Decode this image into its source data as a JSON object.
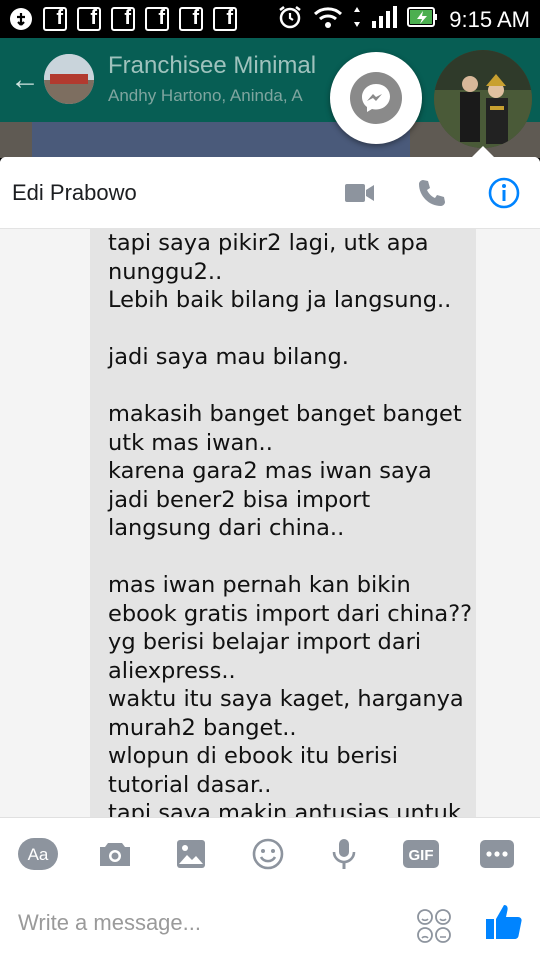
{
  "status_bar": {
    "time": "9:15 AM",
    "icons": [
      "usb-icon",
      "facebook-icon",
      "facebook-icon",
      "facebook-icon",
      "facebook-icon",
      "facebook-icon",
      "facebook-icon",
      "alarm-icon",
      "wifi-icon",
      "signal-icon",
      "battery-charging-icon"
    ]
  },
  "background_app": {
    "title": "Franchisee Minimal",
    "subtitle": "Andhy Hartono, Aninda, A"
  },
  "conversation": {
    "contact_name": "Edi Prabowo",
    "actions": [
      "video-call-icon",
      "phone-call-icon",
      "info-icon"
    ],
    "message_lines": [
      "tapi saya pikir2 lagi, utk apa",
      "nunggu2..",
      "Lebih baik bilang ja langsung..",
      "",
      "jadi saya mau bilang.",
      "",
      "makasih banget banget banget",
      "utk mas iwan..",
      "karena gara2 mas iwan saya",
      "jadi bener2 bisa import",
      "langsung dari china..",
      "",
      "mas iwan pernah kan bikin",
      "ebook gratis import dari china??",
      "yg berisi belajar import dari",
      "aliexpress..",
      "waktu itu saya kaget, harganya",
      "murah2 banget..",
      "wlopun di ebook itu berisi",
      "tutorial dasar..",
      "tapi saya makin antusias untuk"
    ]
  },
  "composer": {
    "aa_label": "Aa",
    "gif_label": "GIF",
    "placeholder": "Write a message...",
    "colors": {
      "accent": "#0084ff",
      "icon_gray": "#8d949e"
    }
  }
}
